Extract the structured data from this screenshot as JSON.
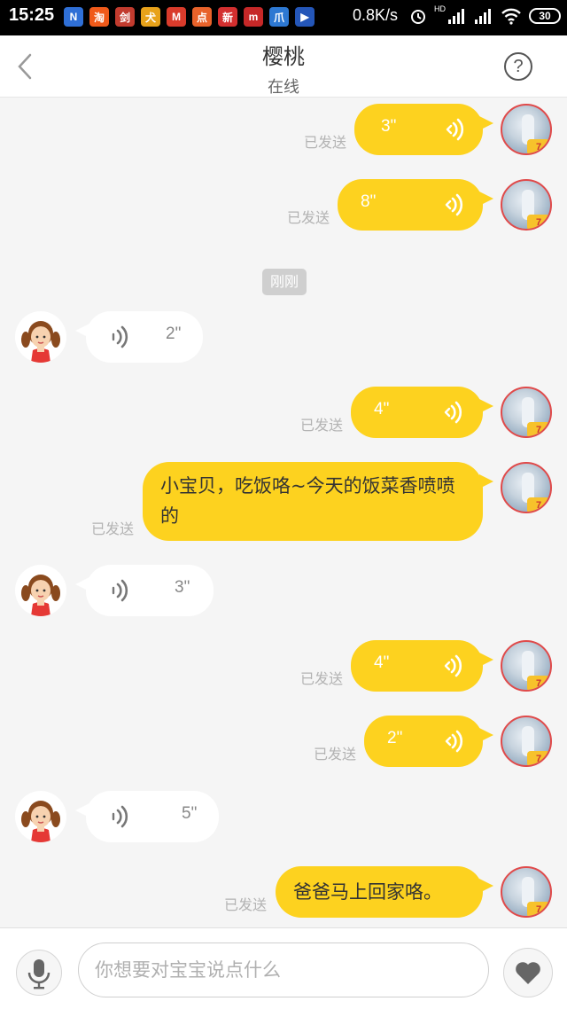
{
  "status_bar": {
    "time": "15:25",
    "network_speed": "0.8K/s",
    "hd_label": "HD",
    "battery": "30",
    "app_icons": [
      {
        "name": "n-app-icon",
        "glyph": "N",
        "color": "#2f6fd6"
      },
      {
        "name": "taobao-icon",
        "glyph": "淘",
        "color": "#f05a1a"
      },
      {
        "name": "game-icon",
        "glyph": "剑",
        "color": "#c23b2e"
      },
      {
        "name": "dog-app-icon",
        "glyph": "犬",
        "color": "#e8a21a"
      },
      {
        "name": "m-app-icon",
        "glyph": "M",
        "color": "#d93b2b"
      },
      {
        "name": "dianping-icon",
        "glyph": "点",
        "color": "#e8622a"
      },
      {
        "name": "news-app-icon",
        "glyph": "新",
        "color": "#d32f2f"
      },
      {
        "name": "mm-app-icon",
        "glyph": "m",
        "color": "#c62828"
      },
      {
        "name": "paw-app-icon",
        "glyph": "爪",
        "color": "#2d78d2"
      },
      {
        "name": "video-app-icon",
        "glyph": "▶",
        "color": "#2456b8"
      }
    ]
  },
  "header": {
    "title": "樱桃",
    "subtitle": "在线",
    "help_glyph": "?"
  },
  "timestamp_chip": "刚刚",
  "sent_label": "已发送",
  "messages": [
    {
      "side": "right",
      "kind": "voice",
      "duration": "3\"",
      "status": "已发送"
    },
    {
      "side": "right",
      "kind": "voice",
      "duration": "8\"",
      "status": "已发送"
    },
    {
      "side": "left",
      "kind": "voice",
      "duration": "2\""
    },
    {
      "side": "right",
      "kind": "voice",
      "duration": "4\"",
      "status": "已发送"
    },
    {
      "side": "right",
      "kind": "text",
      "text": "小宝贝，吃饭咯~今天的饭菜香喷喷的",
      "status": "已发送"
    },
    {
      "side": "left",
      "kind": "voice",
      "duration": "3\""
    },
    {
      "side": "right",
      "kind": "voice",
      "duration": "4\"",
      "status": "已发送"
    },
    {
      "side": "right",
      "kind": "voice",
      "duration": "2\"",
      "status": "已发送"
    },
    {
      "side": "left",
      "kind": "voice",
      "duration": "5\""
    },
    {
      "side": "right",
      "kind": "text",
      "text": "爸爸马上回家咯。",
      "status": "已发送"
    }
  ],
  "avatar_tag": "7",
  "input": {
    "placeholder": "你想要对宝宝说点什么",
    "value": ""
  },
  "colors": {
    "accent_yellow": "#fdd21f",
    "background": "#f5f5f5",
    "status_text": "#b3b3b3"
  }
}
